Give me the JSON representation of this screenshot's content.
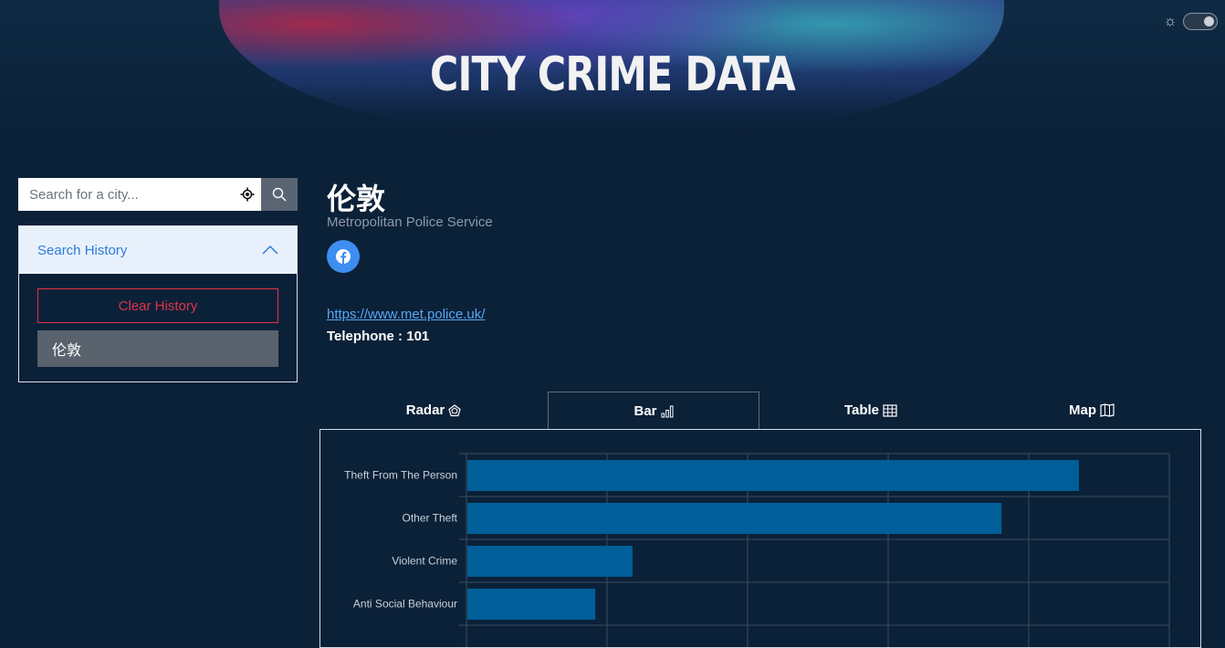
{
  "header": {
    "title": "CITY CRIME DATA"
  },
  "theme": {
    "icon": "sun-icon",
    "toggle_state": "dark"
  },
  "search": {
    "placeholder": "Search for a city...",
    "value": ""
  },
  "history": {
    "title": "Search History",
    "clear_label": "Clear History",
    "items": [
      {
        "label": "伦敦"
      }
    ]
  },
  "city": {
    "name": "伦敦",
    "agency": "Metropolitan Police Service",
    "website": "https://www.met.police.uk/",
    "telephone_label": "Telephone : 101"
  },
  "tabs": [
    {
      "label": "Radar",
      "icon": "pentagon-icon",
      "active": false
    },
    {
      "label": "Bar",
      "icon": "bar-chart-icon",
      "active": true
    },
    {
      "label": "Table",
      "icon": "table-icon",
      "active": false
    },
    {
      "label": "Map",
      "icon": "map-icon",
      "active": false
    }
  ],
  "colors": {
    "accent": "#2f7bd8",
    "danger": "#e0334a",
    "bar": "#005f99",
    "background": "#0b2138"
  },
  "chart_data": {
    "type": "bar",
    "orientation": "horizontal",
    "categories": [
      "Theft From The Person",
      "Other Theft",
      "Violent Crime",
      "Anti Social Behaviour"
    ],
    "values": [
      87,
      76,
      23.5,
      18.2
    ],
    "xlim": [
      0,
      100
    ],
    "grid": true
  }
}
